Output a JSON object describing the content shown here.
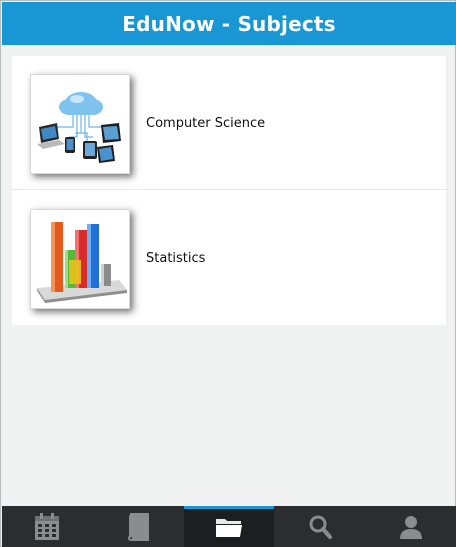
{
  "header": {
    "title": "EduNow - Subjects"
  },
  "subjects": [
    {
      "label": "Computer Science",
      "icon": "cloud-devices-image"
    },
    {
      "label": "Statistics",
      "icon": "bar-chart-image"
    }
  ],
  "tabbar": {
    "tabs": [
      {
        "icon": "calendar-icon",
        "active": false
      },
      {
        "icon": "book-icon",
        "active": false
      },
      {
        "icon": "folder-icon",
        "active": true
      },
      {
        "icon": "search-icon",
        "active": false
      },
      {
        "icon": "user-icon",
        "active": false
      }
    ]
  },
  "colors": {
    "header_bg": "#1997d4",
    "tab_bg": "#2c2d2e",
    "tab_active_indicator": "#1997d4",
    "page_bg": "#f0f1f1",
    "icon_gray": "#8a8c8e"
  }
}
